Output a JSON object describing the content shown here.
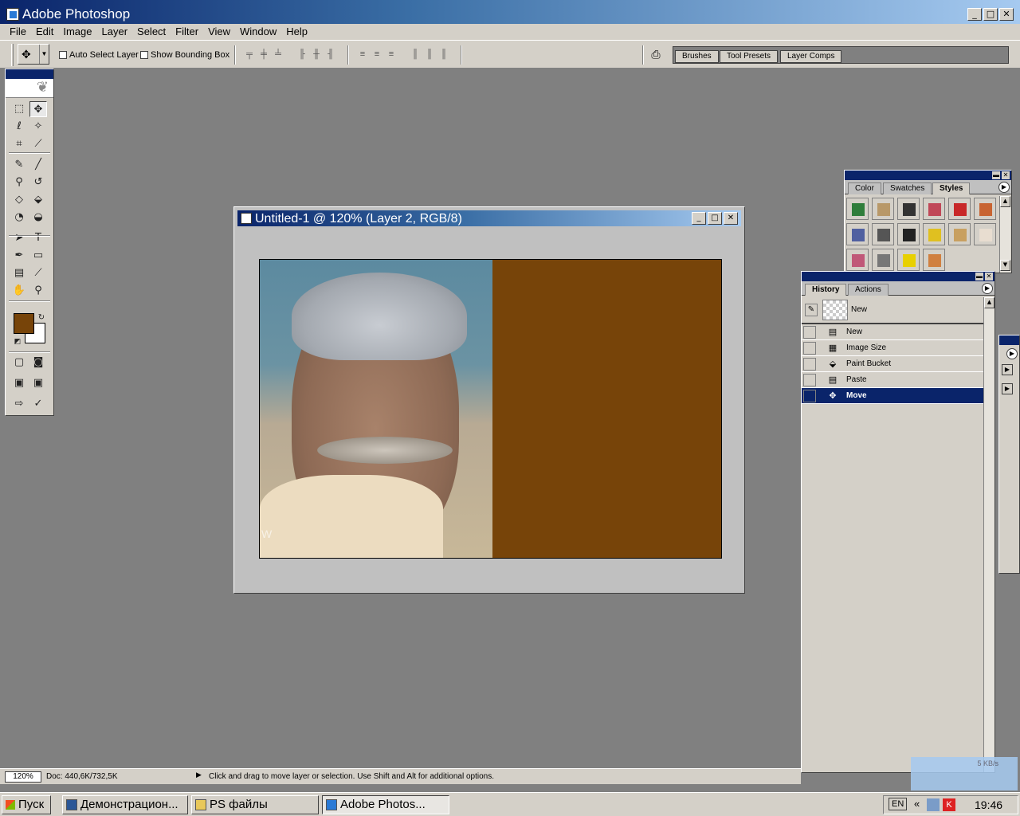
{
  "app": {
    "title": "Adobe Photoshop"
  },
  "window_controls": {
    "minimize": "_",
    "maximize": "□",
    "close": "✕"
  },
  "menu": [
    "File",
    "Edit",
    "Image",
    "Layer",
    "Select",
    "Filter",
    "View",
    "Window",
    "Help"
  ],
  "options_bar": {
    "auto_select_label": "Auto Select Layer",
    "show_bounding_label": "Show Bounding Box",
    "palette_well_tabs": [
      "Brushes",
      "Tool Presets",
      "Layer Comps"
    ]
  },
  "toolbox": {
    "foreground_color": "#774409",
    "background_color": "#ffffff",
    "tools": [
      {
        "name": "marquee-tool",
        "glyph": "⬚"
      },
      {
        "name": "move-tool",
        "glyph": "✥",
        "active": true
      },
      {
        "name": "lasso-tool",
        "glyph": "ℓ"
      },
      {
        "name": "magic-wand-tool",
        "glyph": "✧"
      },
      {
        "name": "crop-tool",
        "glyph": "⌗"
      },
      {
        "name": "slice-tool",
        "glyph": "⟋"
      },
      {
        "name": "healing-brush-tool",
        "glyph": "✎"
      },
      {
        "name": "brush-tool",
        "glyph": "╱"
      },
      {
        "name": "clone-stamp-tool",
        "glyph": "⚲"
      },
      {
        "name": "history-brush-tool",
        "glyph": "↺"
      },
      {
        "name": "eraser-tool",
        "glyph": "◇"
      },
      {
        "name": "paint-bucket-tool",
        "glyph": "⬙"
      },
      {
        "name": "blur-tool",
        "glyph": "◔"
      },
      {
        "name": "dodge-tool",
        "glyph": "◒"
      },
      {
        "name": "path-selection-tool",
        "glyph": "➤"
      },
      {
        "name": "type-tool",
        "glyph": "T"
      },
      {
        "name": "pen-tool",
        "glyph": "✒"
      },
      {
        "name": "shape-tool",
        "glyph": "▭"
      },
      {
        "name": "notes-tool",
        "glyph": "▤"
      },
      {
        "name": "eyedropper-tool",
        "glyph": "⟋"
      },
      {
        "name": "hand-tool",
        "glyph": "✋"
      },
      {
        "name": "zoom-tool",
        "glyph": "⚲"
      }
    ]
  },
  "document": {
    "title": "Untitled-1 @ 120% (Layer 2, RGB/8)",
    "fill_color": "#774409",
    "watermark": "W"
  },
  "styles_palette": {
    "tabs": [
      "Color",
      "Swatches",
      "Styles"
    ],
    "active_tab": "Styles",
    "swatch_colors": [
      "#2f7d3a",
      "#b89868",
      "#333333",
      "#c04858",
      "#c82828",
      "#c86432",
      "#5060a0",
      "#555555",
      "#222222",
      "#e0c020",
      "#c8a060",
      "#e8ddd0",
      "#c05878",
      "#777777",
      "#e8d000",
      "#d08040"
    ]
  },
  "history_palette": {
    "tabs": [
      "History",
      "Actions"
    ],
    "active_tab": "History",
    "snapshot_label": "New",
    "items": [
      {
        "label": "New",
        "icon": "▤"
      },
      {
        "label": "Image Size",
        "icon": "▦"
      },
      {
        "label": "Paint Bucket",
        "icon": "⬙"
      },
      {
        "label": "Paste",
        "icon": "▤"
      },
      {
        "label": "Move",
        "icon": "✥",
        "selected": true
      }
    ]
  },
  "status_bar": {
    "zoom": "120%",
    "doc_info": "Doc: 440,6K/732,5K",
    "message": "Click and drag to move layer or selection.  Use Shift and Alt for additional options."
  },
  "net_widget": {
    "speed": "5 KB/s"
  },
  "taskbar": {
    "start_label": "Пуск",
    "tasks": [
      {
        "label": "Демонстрацион...",
        "active": false
      },
      {
        "label": "PS файлы",
        "active": false
      },
      {
        "label": "Adobe Photos...",
        "active": true
      }
    ],
    "lang": "EN",
    "clock": "19:46"
  }
}
